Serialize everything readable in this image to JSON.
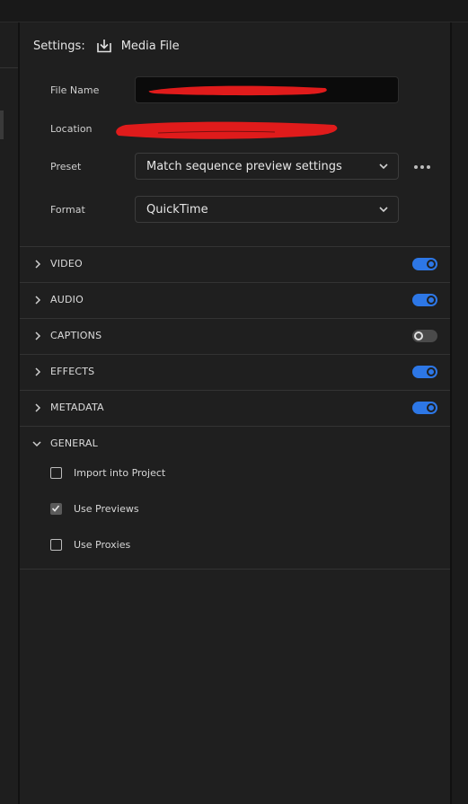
{
  "header": {
    "settings_label": "Settings:",
    "destination_label": "Media File"
  },
  "fields": {
    "file_name_label": "File Name",
    "location_label": "Location",
    "preset_label": "Preset",
    "preset_value": "Match sequence preview settings",
    "format_label": "Format",
    "format_value": "QuickTime"
  },
  "sections": [
    {
      "title": "VIDEO",
      "enabled": true
    },
    {
      "title": "AUDIO",
      "enabled": true
    },
    {
      "title": "CAPTIONS",
      "enabled": false
    },
    {
      "title": "EFFECTS",
      "enabled": true
    },
    {
      "title": "METADATA",
      "enabled": true
    }
  ],
  "general": {
    "title": "GENERAL",
    "options": [
      {
        "label": "Import into Project",
        "checked": false
      },
      {
        "label": "Use Previews",
        "checked": true
      },
      {
        "label": "Use Proxies",
        "checked": false
      }
    ]
  },
  "colors": {
    "toggle_on": "#2d77e6",
    "redaction": "#e01b1b"
  }
}
